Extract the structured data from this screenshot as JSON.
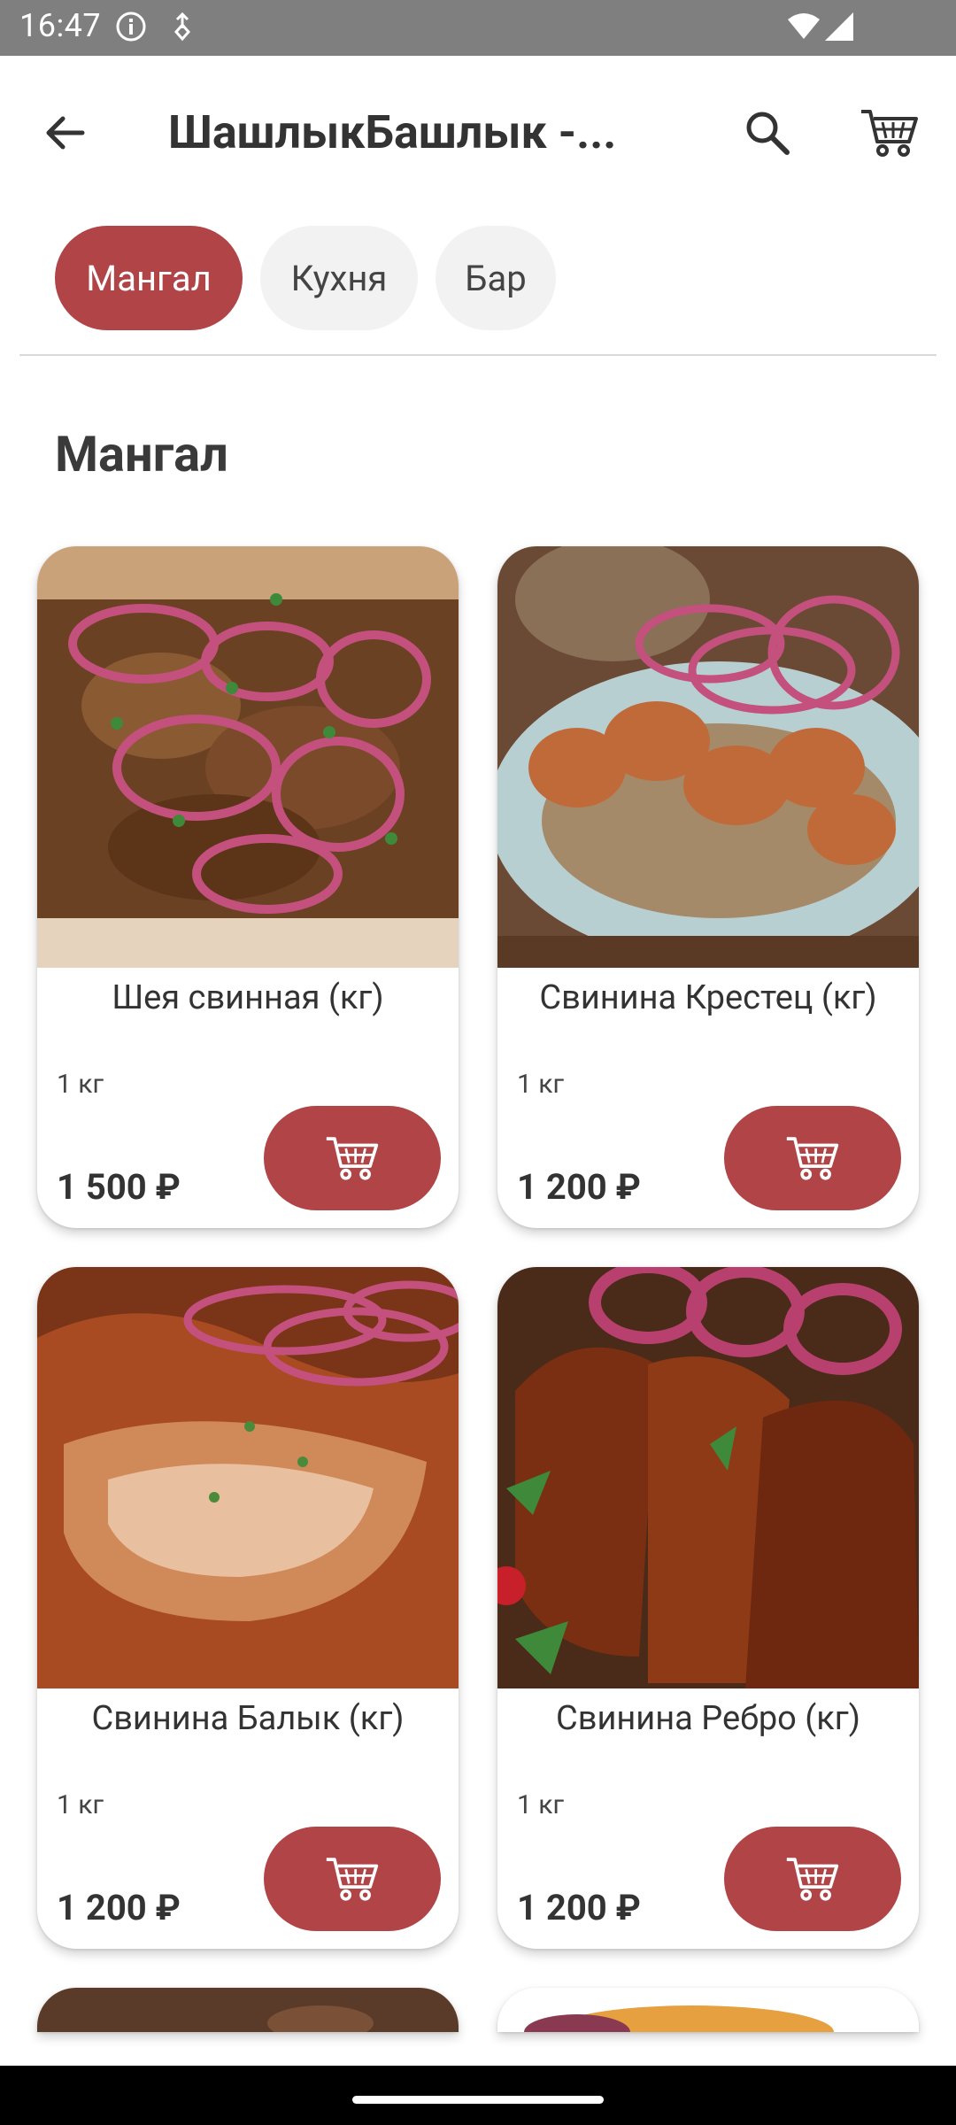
{
  "status_bar": {
    "time": "16:47"
  },
  "header": {
    "title": "ШашлыкБашлык -..."
  },
  "tabs": [
    {
      "label": "Мангал",
      "active": true
    },
    {
      "label": "Кухня",
      "active": false
    },
    {
      "label": "Бар",
      "active": false
    }
  ],
  "section": {
    "title": "Мангал"
  },
  "products": [
    {
      "name": "Шея свинная (кг)",
      "weight": "1 кг",
      "price": "1 500 ₽",
      "image": "pork-neck-skewers-with-onions"
    },
    {
      "name": "Свинина Крестец (кг)",
      "weight": "1 кг",
      "price": "1 200 ₽",
      "image": "pork-loin-pieces-with-onions"
    },
    {
      "name": "Свинина Балык (кг)",
      "weight": "1 кг",
      "price": "1 200 ₽",
      "image": "grilled-pork-steak-with-onions"
    },
    {
      "name": "Свинина Ребро (кг)",
      "weight": "1 кг",
      "price": "1 200 ₽",
      "image": "grilled-pork-ribs-with-salad"
    }
  ],
  "colors": {
    "accent": "#b04446",
    "status_bar": "#7f7f7f",
    "tab_inactive": "#f2f2f2"
  }
}
